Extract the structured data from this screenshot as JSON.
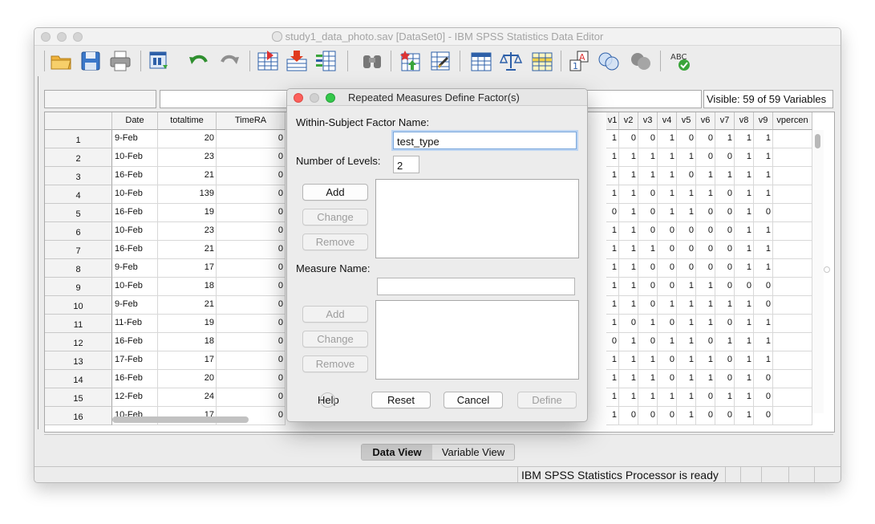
{
  "window": {
    "title": "study1_data_photo.sav [DataSet0] - IBM SPSS Statistics Data Editor"
  },
  "toolbar": {
    "icons": [
      "open-folder-icon",
      "save-icon",
      "print-icon",
      "recall-dialog-icon",
      "undo-icon",
      "redo-icon",
      "goto-case-icon",
      "insert-cases-icon",
      "variables-icon",
      "find-icon",
      "insert-variable-icon",
      "split-file-icon",
      "value-labels-icon",
      "weight-cases-icon",
      "select-cases-icon",
      "value-labels-a1-icon",
      "use-sets-icon",
      "show-all-variables-icon",
      "spell-check-icon"
    ]
  },
  "cellbar": {
    "visible_text": "Visible: 59 of 59 Variables"
  },
  "grid": {
    "columns": [
      "Date",
      "totaltime",
      "TimeRA",
      "v1",
      "v2",
      "v3",
      "v4",
      "v5",
      "v6",
      "v7",
      "v8",
      "v9",
      "vpercen"
    ],
    "rows": [
      {
        "n": "1",
        "date": "9-Feb",
        "totaltime": "20",
        "timera": "0",
        "v": [
          "1",
          "0",
          "0",
          "1",
          "0",
          "0",
          "1",
          "1",
          "1"
        ]
      },
      {
        "n": "2",
        "date": "10-Feb",
        "totaltime": "23",
        "timera": "0",
        "v": [
          "1",
          "1",
          "1",
          "1",
          "1",
          "0",
          "0",
          "1",
          "1"
        ]
      },
      {
        "n": "3",
        "date": "16-Feb",
        "totaltime": "21",
        "timera": "0",
        "v": [
          "1",
          "1",
          "1",
          "1",
          "0",
          "1",
          "1",
          "1",
          "1"
        ]
      },
      {
        "n": "4",
        "date": "10-Feb",
        "totaltime": "139",
        "timera": "0",
        "v": [
          "1",
          "1",
          "0",
          "1",
          "1",
          "1",
          "0",
          "1",
          "1"
        ]
      },
      {
        "n": "5",
        "date": "16-Feb",
        "totaltime": "19",
        "timera": "0",
        "v": [
          "0",
          "1",
          "0",
          "1",
          "1",
          "0",
          "0",
          "1",
          "0"
        ]
      },
      {
        "n": "6",
        "date": "10-Feb",
        "totaltime": "23",
        "timera": "0",
        "v": [
          "1",
          "1",
          "0",
          "0",
          "0",
          "0",
          "0",
          "1",
          "1"
        ]
      },
      {
        "n": "7",
        "date": "16-Feb",
        "totaltime": "21",
        "timera": "0",
        "v": [
          "1",
          "1",
          "1",
          "0",
          "0",
          "0",
          "0",
          "1",
          "1"
        ]
      },
      {
        "n": "8",
        "date": "9-Feb",
        "totaltime": "17",
        "timera": "0",
        "v": [
          "1",
          "1",
          "0",
          "0",
          "0",
          "0",
          "0",
          "1",
          "1"
        ]
      },
      {
        "n": "9",
        "date": "10-Feb",
        "totaltime": "18",
        "timera": "0",
        "v": [
          "1",
          "1",
          "0",
          "0",
          "1",
          "1",
          "0",
          "0",
          "0"
        ]
      },
      {
        "n": "10",
        "date": "9-Feb",
        "totaltime": "21",
        "timera": "0",
        "v": [
          "1",
          "1",
          "0",
          "1",
          "1",
          "1",
          "1",
          "1",
          "0"
        ]
      },
      {
        "n": "11",
        "date": "11-Feb",
        "totaltime": "19",
        "timera": "0",
        "v": [
          "1",
          "0",
          "1",
          "0",
          "1",
          "1",
          "0",
          "1",
          "1"
        ]
      },
      {
        "n": "12",
        "date": "16-Feb",
        "totaltime": "18",
        "timera": "0",
        "v": [
          "0",
          "1",
          "0",
          "1",
          "1",
          "0",
          "1",
          "1",
          "1"
        ]
      },
      {
        "n": "13",
        "date": "17-Feb",
        "totaltime": "17",
        "timera": "0",
        "v": [
          "1",
          "1",
          "1",
          "0",
          "1",
          "1",
          "0",
          "1",
          "1"
        ]
      },
      {
        "n": "14",
        "date": "16-Feb",
        "totaltime": "20",
        "timera": "0",
        "v": [
          "1",
          "1",
          "1",
          "0",
          "1",
          "1",
          "0",
          "1",
          "0"
        ]
      },
      {
        "n": "15",
        "date": "12-Feb",
        "totaltime": "24",
        "timera": "0",
        "v": [
          "1",
          "1",
          "1",
          "1",
          "1",
          "0",
          "1",
          "1",
          "0"
        ]
      },
      {
        "n": "16",
        "date": "10-Feb",
        "totaltime": "17",
        "timera": "0",
        "v": [
          "1",
          "0",
          "0",
          "0",
          "1",
          "0",
          "0",
          "1",
          "0"
        ]
      }
    ]
  },
  "view_tabs": {
    "data_view": "Data View",
    "variable_view": "Variable View"
  },
  "status": {
    "text": "IBM SPSS Statistics Processor is ready"
  },
  "dialog": {
    "title": "Repeated Measures Define Factor(s)",
    "factor_name_label": "Within-Subject Factor Name:",
    "factor_name_value": "test_type",
    "levels_label": "Number of Levels:",
    "levels_value": "2",
    "factor_buttons": {
      "add": "Add",
      "change": "Change",
      "remove": "Remove"
    },
    "measure_name_label": "Measure Name:",
    "measure_name_value": "",
    "measure_buttons": {
      "add": "Add",
      "change": "Change",
      "remove": "Remove"
    },
    "footer": {
      "help": "Help",
      "reset": "Reset",
      "cancel": "Cancel",
      "define": "Define"
    },
    "colors": {
      "close": "#fc605c",
      "minimize": "#d0d0d0",
      "zoom": "#34c84a"
    }
  }
}
